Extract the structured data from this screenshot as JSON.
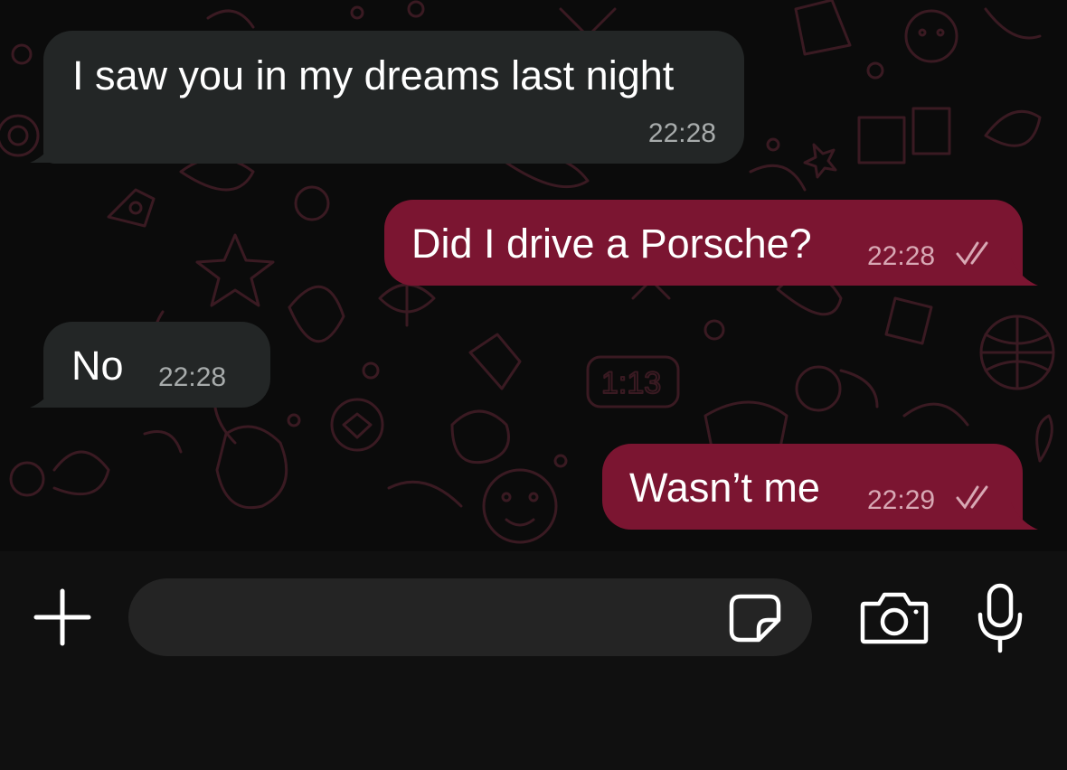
{
  "messages": [
    {
      "direction": "incoming",
      "text": "I saw you in my dreams last night",
      "time": "22:28"
    },
    {
      "direction": "outgoing",
      "text": "Did I drive a Porsche?",
      "time": "22:28",
      "status": "read"
    },
    {
      "direction": "incoming",
      "text": "No",
      "time": "22:28"
    },
    {
      "direction": "outgoing",
      "text": "Wasn’t me",
      "time": "22:29",
      "status": "read"
    }
  ],
  "composer": {
    "input_value": "",
    "icons": {
      "attach": "plus-icon",
      "sticker": "sticker-icon",
      "camera": "camera-icon",
      "mic": "microphone-icon"
    }
  },
  "colors": {
    "incoming_bubble": "#232626",
    "outgoing_bubble": "#7b1531",
    "chat_background": "#0b0b0b",
    "doodle_stroke": "#3a1a22",
    "composer_background": "#101010"
  }
}
